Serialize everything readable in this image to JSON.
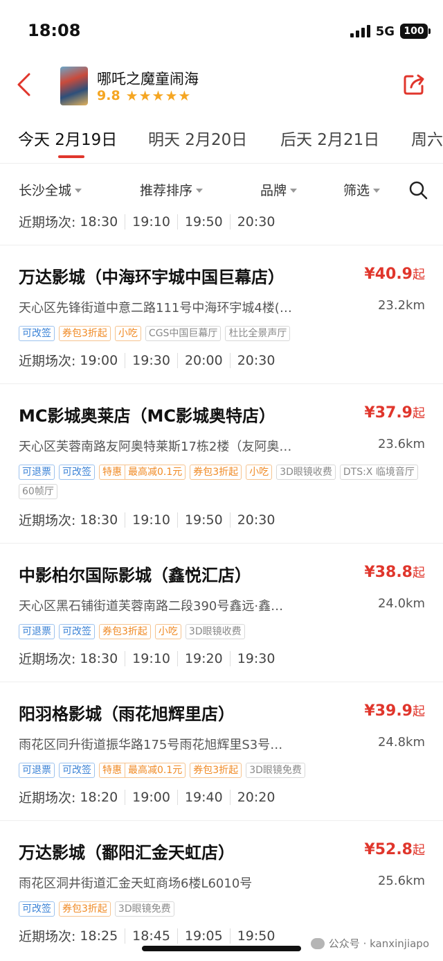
{
  "status_bar": {
    "time": "18:08",
    "network": "5G",
    "battery": "100"
  },
  "movie": {
    "title": "哪吒之魔童闹海",
    "rating": "9.8",
    "stars": "★★★★★"
  },
  "date_tabs": [
    {
      "label": "今天 2月19日"
    },
    {
      "label": "明天 2月20日"
    },
    {
      "label": "后天 2月21日"
    },
    {
      "label": "周六"
    }
  ],
  "filters": {
    "area": "长沙全城",
    "sort": "推荐排序",
    "brand": "品牌",
    "filter": "筛选"
  },
  "times_label": "近期场次:",
  "price_unit": "起",
  "partial_item": {
    "times": [
      "18:30",
      "19:10",
      "19:50",
      "20:30"
    ]
  },
  "cinemas": [
    {
      "name": "万达影城（中海环宇城中国巨幕店）",
      "price": "¥40.9",
      "address": "天心区先锋街道中意二路111号中海环宇城4楼(…",
      "distance": "23.2km",
      "tags": [
        "可改签",
        "券包3折起",
        "小吃",
        "CGS中国巨幕厅",
        "杜比全景声厅"
      ],
      "times": [
        "19:00",
        "19:30",
        "20:00",
        "20:30"
      ]
    },
    {
      "name": "MC影城奥莱店（MC影城奥特店）",
      "price": "¥37.9",
      "address": "天心区芙蓉南路友阿奥特莱斯17栋2楼（友阿奥…",
      "distance": "23.6km",
      "tags": [
        "可退票",
        "可改签",
        "特惠",
        "最高减0.1元",
        "券包3折起",
        "小吃",
        "3D眼镜收费",
        "DTS:X 临境音厅",
        "60帧厅"
      ],
      "times": [
        "18:30",
        "19:10",
        "19:50",
        "20:30"
      ]
    },
    {
      "name": "中影柏尔国际影城（鑫悦汇店）",
      "price": "¥38.8",
      "address": "天心区黑石铺街道芙蓉南路二段390号鑫远·鑫…",
      "distance": "24.0km",
      "tags": [
        "可退票",
        "可改签",
        "券包3折起",
        "小吃",
        "3D眼镜收费"
      ],
      "times": [
        "18:30",
        "19:10",
        "19:20",
        "19:30"
      ]
    },
    {
      "name": "阳羽格影城（雨花旭辉里店）",
      "price": "¥39.9",
      "address": "雨花区同升街道振华路175号雨花旭辉里S3号…",
      "distance": "24.8km",
      "tags": [
        "可退票",
        "可改签",
        "特惠",
        "最高减0.1元",
        "券包3折起",
        "3D眼镜免费"
      ],
      "times": [
        "18:20",
        "19:00",
        "19:40",
        "20:20"
      ]
    },
    {
      "name": "万达影城（鄱阳汇金天虹店）",
      "price": "¥52.8",
      "address": "雨花区洞井街道汇金天虹商场6楼L6010号",
      "distance": "25.6km",
      "tags": [
        "可改签",
        "券包3折起",
        "3D眼镜免费"
      ],
      "times": [
        "18:25",
        "18:45",
        "19:05",
        "19:50"
      ]
    }
  ],
  "watermark": "公众号 · kanxinjiapo",
  "colors": {
    "accent": "#e0362c",
    "star": "#f5a623",
    "tag_blue": "#3a82d6",
    "tag_orange": "#f08a24",
    "tag_gray": "#888888"
  }
}
